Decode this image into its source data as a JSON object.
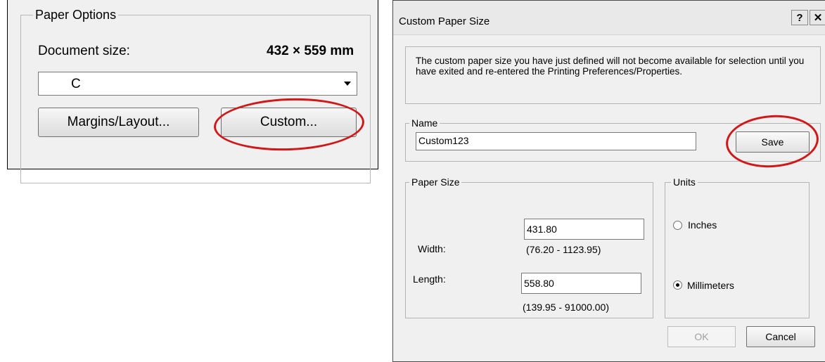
{
  "left_panel": {
    "group_title": "Paper Options",
    "document_size_label": "Document size:",
    "document_size_value": "432 × 559 mm",
    "size_select_value": "C",
    "margins_button": "Margins/Layout...",
    "custom_button": "Custom..."
  },
  "dialog": {
    "title": "Custom Paper Size",
    "help_button": "?",
    "close_button": "✕",
    "info_text": "The custom paper size you have just defined will not become available for selection until you have exited and re-entered the Printing Preferences/Properties.",
    "name_group": {
      "title": "Name",
      "value": "Custom123",
      "save_button": "Save"
    },
    "paper_size_group": {
      "title": "Paper Size",
      "width_label": "Width:",
      "width_value": "431.80",
      "width_range": "(76.20 - 1123.95)",
      "length_label": "Length:",
      "length_value": "558.80",
      "length_range": "(139.95 - 91000.00)"
    },
    "units_group": {
      "title": "Units",
      "inches_label": "Inches",
      "millimeters_label": "Millimeters",
      "selected": "Millimeters"
    },
    "ok_button": "OK",
    "cancel_button": "Cancel"
  },
  "colors": {
    "highlight_ellipse": "#d01818",
    "dialog_bg": "#f0f0f0"
  }
}
